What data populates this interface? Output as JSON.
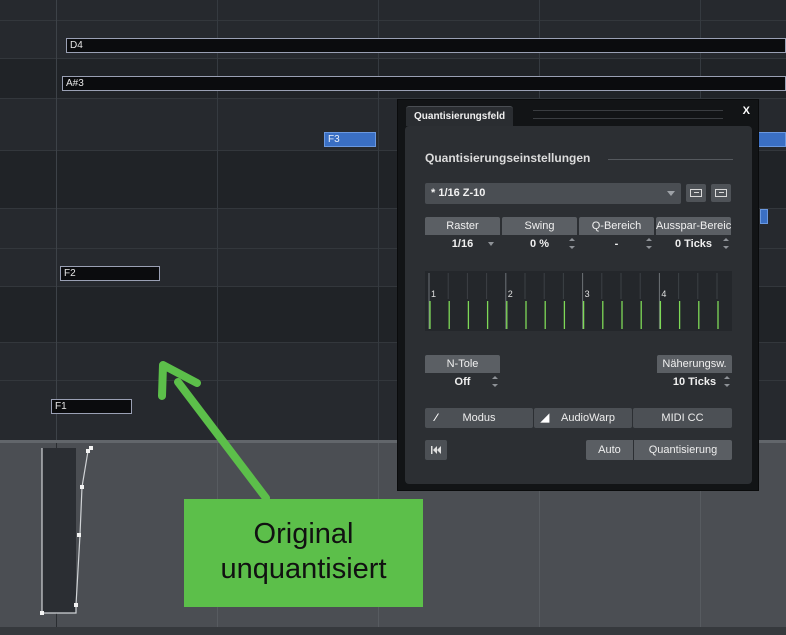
{
  "piano_roll": {
    "notes": [
      {
        "label": "D4"
      },
      {
        "label": "A#3"
      },
      {
        "label": "F3"
      },
      {
        "label": "F2"
      },
      {
        "label": "F1"
      }
    ]
  },
  "quantize_panel": {
    "tab_title": "Quantisierungsfeld",
    "close_label": "X",
    "section_title": "Quantisierungseinstellungen",
    "preset_value": "* 1/16  Z-10",
    "params": [
      {
        "label": "Raster",
        "value": "1/16"
      },
      {
        "label": "Swing",
        "value": "0 %"
      },
      {
        "label": "Q-Bereich",
        "value": "-"
      },
      {
        "label": "Ausspar-Bereich",
        "value": "0 Ticks"
      }
    ],
    "grid_beats": [
      "1",
      "2",
      "3",
      "4"
    ],
    "ntole": {
      "label": "N-Tole",
      "value": "Off"
    },
    "naeherung": {
      "label": "Näherungsw.",
      "value": "10 Ticks"
    },
    "mode_buttons": {
      "modus": "Modus",
      "audiowarp": "AudioWarp",
      "midicc": "MIDI CC"
    },
    "actions": {
      "auto": "Auto",
      "quantize": "Quantisierung"
    }
  },
  "callout": {
    "line1": "Original",
    "line2": "unquantisiert",
    "color": "#5cbf4a"
  }
}
